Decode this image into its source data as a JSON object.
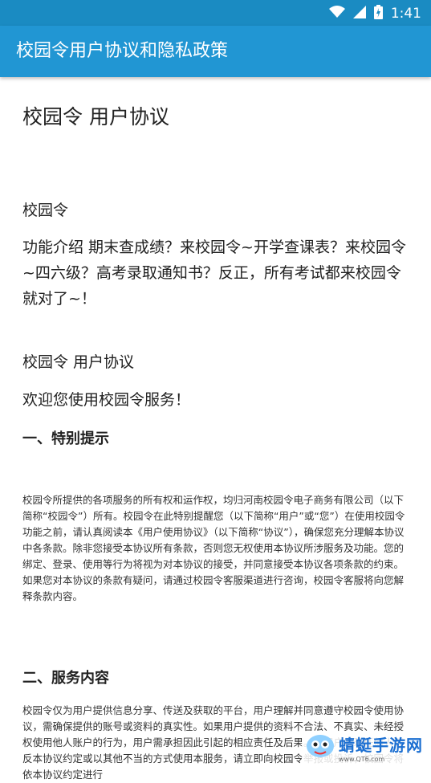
{
  "status_bar": {
    "time": "1:41",
    "icons": [
      "wifi-icon",
      "signal-icon",
      "battery-icon"
    ]
  },
  "toolbar": {
    "title": "校园令用户协议和隐私政策"
  },
  "document": {
    "title": "校园令 用户协议",
    "app_name": "校园令",
    "intro": "功能介绍 期末查成绩？来校园令~开学查课表？来校园令~四六级？高考录取通知书？反正，所有考试都来校园令就对了~！",
    "agreement_heading": "校园令 用户协议",
    "welcome": "欢迎您使用校园令服务！",
    "section1_title": "一、特别提示",
    "section1_text": "校园令所提供的各项服务的所有权和运作权，均归河南校园令电子商务有限公司（以下简称“校园令”）所有。校园令在此特别提醒您（以下简称“用户”或“您”）在使用校园令功能之前，请认真阅读本《用户使用协议》（以下简称“协议”），确保您充分理解本协议中各条款。除非您接受本协议所有条款，否则您无权使用本协议所涉服务及功能。您的绑定、登录、使用等行为将视为对本协议的接受，并同意接受本协议各项条款的约束。如果您对本协议的条款有疑问，请通过校园令客服渠道进行咨询，校园令客服将向您解释条款内容。",
    "section2_title": "二、服务内容",
    "section2_text": "校园令仅为用户提供信息分享、传送及获取的平台，用户理解并同意遵守校园令使用协议，需确保提供的账号或资料的真实性。如果用户提供的资料不合法、不真实、未经授权使用他人账户的行为，用户需承担因此引起的相应责任及后果。如用户发现任何人违反本协议约定或以其他不当的方式使用本服务，请立即向校园令举报或投诉，校园令将依本协议约定进行"
  },
  "watermark": {
    "text": "蜻蜓手游网",
    "url": "www.QT6.com"
  },
  "colors": {
    "status_bar": "#1a8bc2",
    "toolbar": "#2196d3",
    "text": "#212121"
  }
}
